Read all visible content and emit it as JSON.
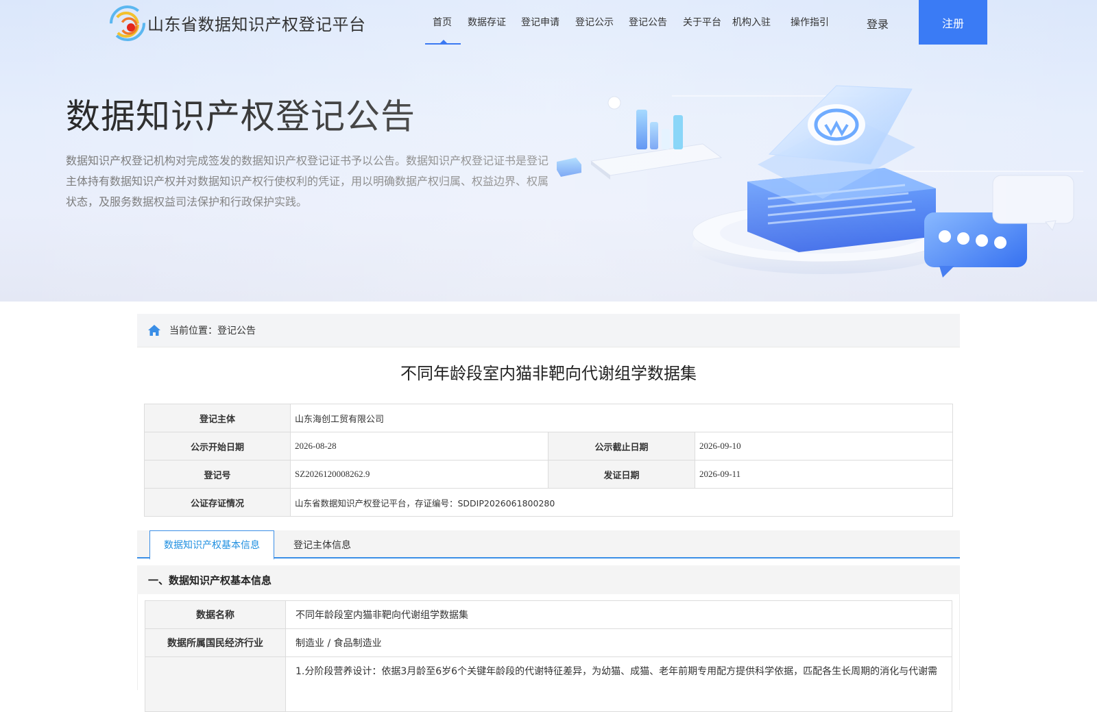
{
  "header": {
    "site_title": "山东省数据知识产权登记平台",
    "nav": [
      "首页",
      "数据存证",
      "登记申请",
      "登记公示",
      "登记公告",
      "关于平台",
      "机构入驻",
      "操作指引"
    ],
    "active_nav": "首页",
    "login_label": "登录",
    "register_label": "注册"
  },
  "hero": {
    "title": "数据知识产权登记公告",
    "description": "数据知识产权登记机构对完成签发的数据知识产权登记证书予以公告。数据知识产权登记证书是登记主体持有数据知识产权并对数据知识产权行使权利的凭证，用以明确数据产权归属、权益边界、权属状态，及服务数据权益司法保护和行政保护实践。"
  },
  "breadcrumb": {
    "text": "当前位置：登记公告"
  },
  "record": {
    "title": "不同年龄段室内猫非靶向代谢组学数据集",
    "labels": {
      "registrant": "登记主体",
      "start_date": "公示开始日期",
      "end_date": "公示截止日期",
      "reg_no": "登记号",
      "issue_date": "发证日期",
      "notary": "公证存证情况"
    },
    "registrant": "山东海创工贸有限公司",
    "start_date": "2026-08-28",
    "end_date": "2026-09-10",
    "reg_no": "SZ2026120008262.9",
    "issue_date": "2026-09-11",
    "notary": "山东省数据知识产权登记平台，存证编号：SDDIP2026061800280"
  },
  "tabs": {
    "active": "数据知识产权基本信息",
    "second": "登记主体信息"
  },
  "section": {
    "heading": "一、数据知识产权基本信息",
    "rows": [
      {
        "label": "数据名称",
        "value": "不同年龄段室内猫非靶向代谢组学数据集"
      },
      {
        "label": "数据所属国民经济行业",
        "value": "制造业 / 食品制造业"
      },
      {
        "label": "",
        "value": "1.分阶段营养设计：依据3月龄至6岁6个关键年龄段的代谢特征差异，为幼猫、成猫、老年前期专用配方提供科学依据，匹配各生长周期的消化与代谢需"
      }
    ]
  }
}
